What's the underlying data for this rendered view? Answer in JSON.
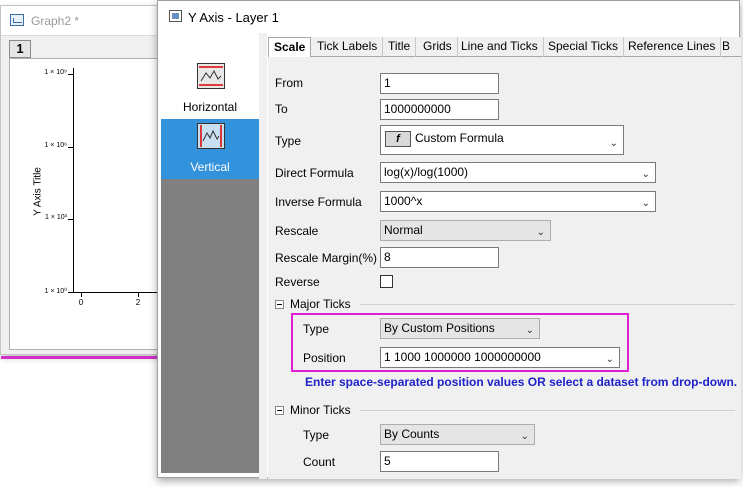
{
  "graph_window": {
    "title": "Graph2 *",
    "page_number": "1",
    "y_title": "Y Axis Title",
    "y_ticks": [
      "1 × 10⁹",
      "1 × 10⁶",
      "1 × 10³",
      "1 × 10⁰"
    ],
    "x_ticks": [
      "0",
      "2"
    ]
  },
  "dialog": {
    "title": "Y Axis - Layer 1",
    "left_items": [
      "Horizontal",
      "Vertical"
    ],
    "tabs": [
      "Scale",
      "Tick Labels",
      "Title",
      "Grids",
      "Line and Ticks",
      "Special Ticks",
      "Reference Lines",
      "B"
    ],
    "active_tab": "Scale",
    "from_label": "From",
    "from_value": "1",
    "to_label": "To",
    "to_value": "1000000000",
    "type_label": "Type",
    "type_value": "Custom Formula",
    "type_icon_glyph": "f",
    "direct_formula_label": "Direct Formula",
    "direct_formula_value": "log(x)/log(1000)",
    "inverse_formula_label": "Inverse Formula",
    "inverse_formula_value": "1000^x",
    "rescale_label": "Rescale",
    "rescale_value": "Normal",
    "rescale_margin_label": "Rescale Margin(%)",
    "rescale_margin_value": "8",
    "reverse_label": "Reverse",
    "reverse_checked": false,
    "major_ticks": {
      "header": "Major Ticks",
      "type_label": "Type",
      "type_value": "By Custom Positions",
      "position_label": "Position",
      "position_value": "1 1000 1000000 1000000000",
      "hint": "Enter space-separated position values OR select a dataset from drop-down."
    },
    "minor_ticks": {
      "header": "Minor Ticks",
      "type_label": "Type",
      "type_value": "By Counts",
      "count_label": "Count",
      "count_value": "5"
    }
  },
  "colors": {
    "highlight": "#e01ed6",
    "hint_text": "#1e22c8",
    "selected_item": "#3392dc"
  }
}
